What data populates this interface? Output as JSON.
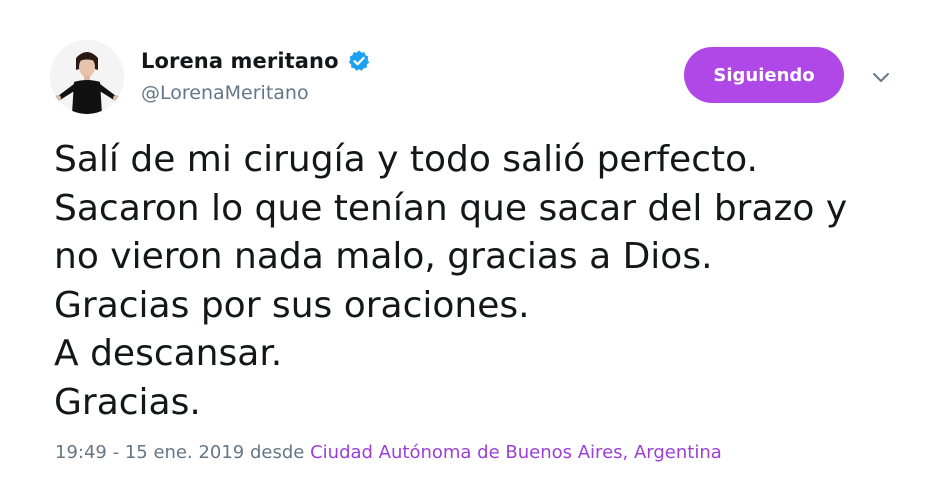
{
  "user": {
    "display_name": "Lorena meritano",
    "handle": "@LorenaMeritano",
    "verified": true
  },
  "follow_button": {
    "label": "Siguiendo"
  },
  "tweet": {
    "lines": [
      "Salí de mi cirugía y todo salió perfecto.",
      "Sacaron lo que tenían que sacar del brazo y",
      "no vieron nada malo, gracias a Dios.",
      "Gracias por sus oraciones.",
      "A descansar.",
      "Gracias."
    ]
  },
  "meta": {
    "time": "19:49",
    "separator": " - ",
    "date": "15 ene. 2019",
    "from_word": " desde ",
    "place": "Ciudad Autónoma de Buenos Aires, Argentina"
  },
  "icons": {
    "verified": "verified-badge-icon",
    "caret": "chevron-down-icon"
  },
  "colors": {
    "follow_button": "#b048e8",
    "place_link": "#9b3fd6",
    "verified": "#1da1f2",
    "muted_text": "#657786",
    "main_text": "#14171a"
  }
}
